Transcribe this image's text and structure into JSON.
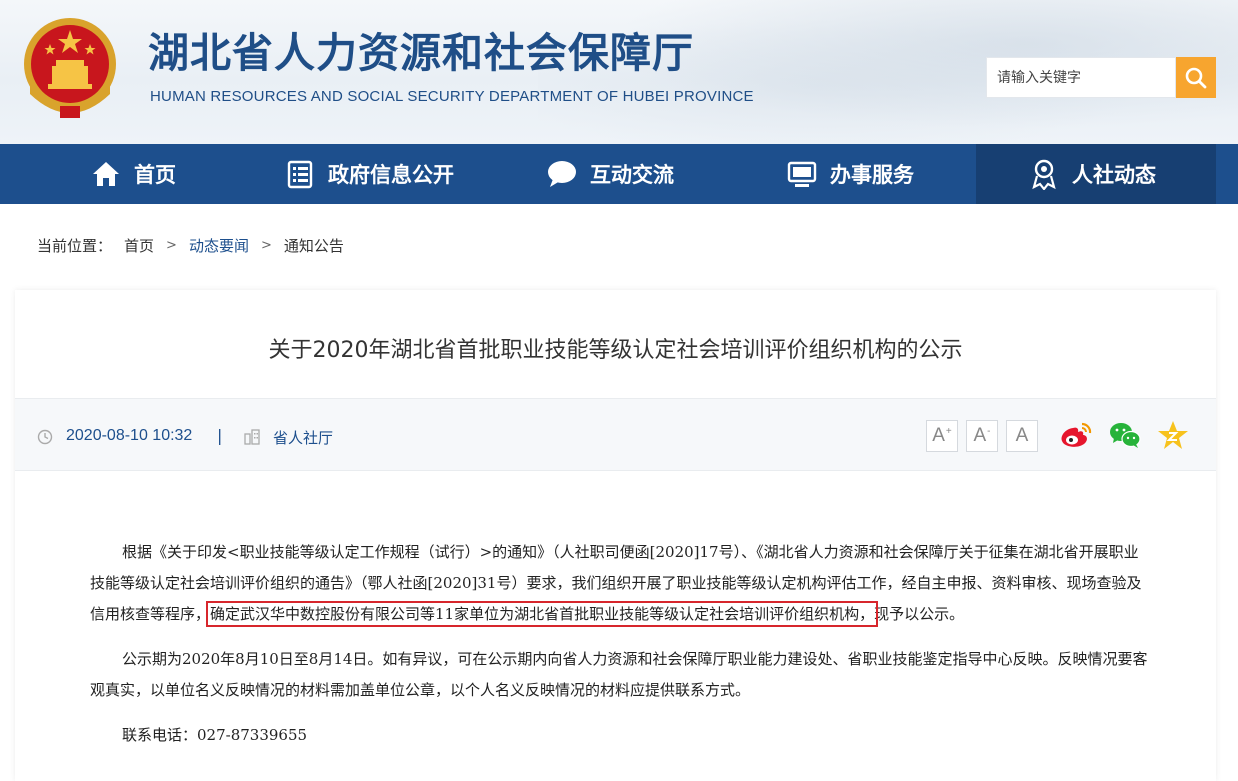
{
  "header": {
    "title": "湖北省人力资源和社会保障厅",
    "subtitle": "HUMAN RESOURCES AND SOCIAL SECURITY DEPARTMENT OF HUBEI PROVINCE",
    "search_placeholder": "请输入关键字"
  },
  "nav": {
    "items": [
      {
        "label": "首页",
        "icon": "home-icon"
      },
      {
        "label": "政府信息公开",
        "icon": "document-list-icon"
      },
      {
        "label": "互动交流",
        "icon": "chat-bubble-icon"
      },
      {
        "label": "办事服务",
        "icon": "monitor-icon"
      },
      {
        "label": "人社动态",
        "icon": "person-badge-icon"
      }
    ]
  },
  "breadcrumb": {
    "prefix": "当前位置：",
    "items": [
      "首页",
      "动态要闻",
      "通知公告"
    ],
    "separator": ">"
  },
  "article": {
    "title": "关于2020年湖北省首批职业技能等级认定社会培训评价组织机构的公示",
    "date": "2020-08-10 10:32",
    "divider": "|",
    "source": "省人社厅",
    "font_buttons": [
      "A",
      "A",
      "A"
    ],
    "para1_a": "根据《关于印发<职业技能等级认定工作规程（试行）>的通知》（人社职司便函[2020]17号）、《湖北省人力资源和社会保障厅关于征集在湖北省开展职业技能等级认定社会培训评价组织的通告》（鄂人社函[2020]31号）要求，我们组织开展了职业技能等级认定机构评估工作，经自主申报、资料审核、现场查验及信用核查等程序，",
    "para1_highlight": "确定武汉华中数控股份有限公司等11家单位为湖北省首批职业技能等级认定社会培训评价组织机构，",
    "para1_b": "现予以公示。",
    "para2": "公示期为2020年8月10日至8月14日。如有异议，可在公示期内向省人力资源和社会保障厅职业能力建设处、省职业技能鉴定指导中心反映。反映情况要客观真实，以单位名义反映情况的材料需加盖单位公章，以个人名义反映情况的材料应提供联系方式。",
    "para3": "联系电话：027-87339655"
  },
  "colors": {
    "brand_blue": "#1d4f8d",
    "search_orange": "#f7a52f",
    "highlight_red": "#d7262c"
  }
}
